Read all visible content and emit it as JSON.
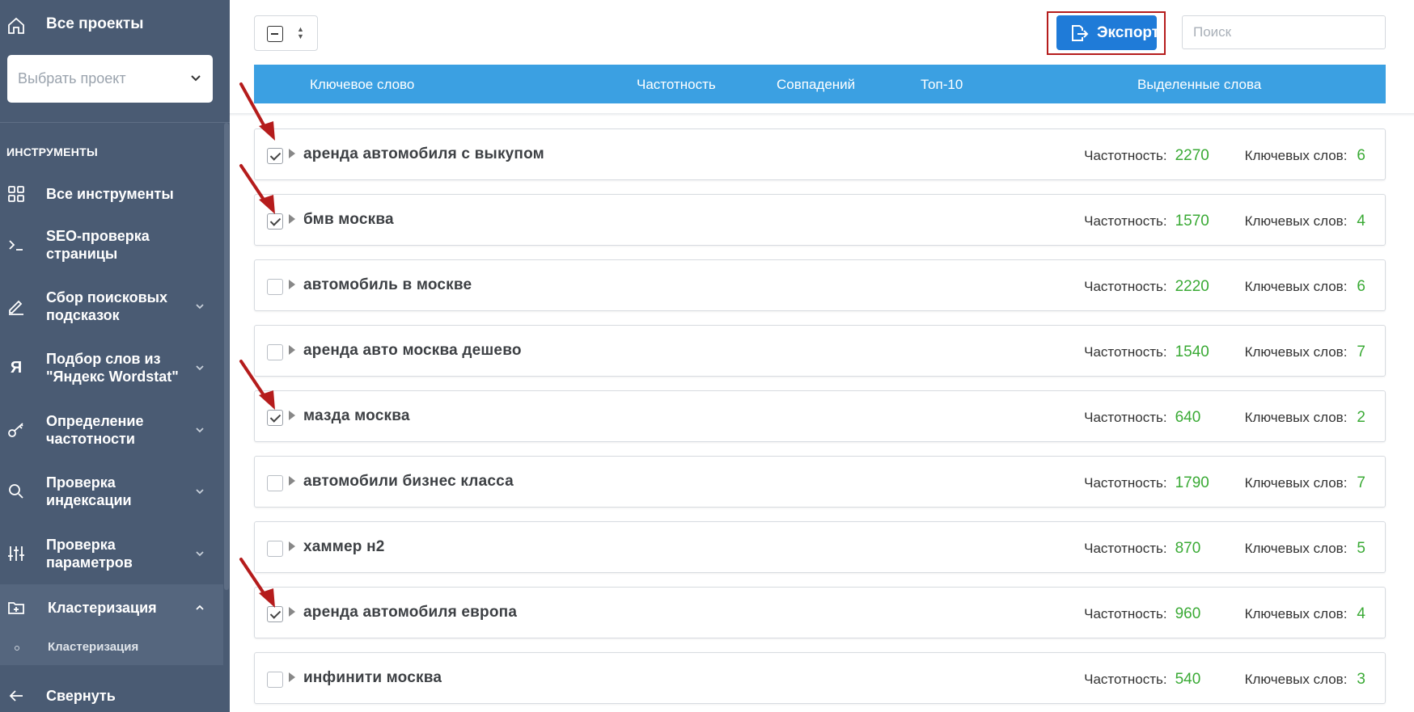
{
  "sidebar": {
    "all_projects": "Все проекты",
    "project_select_placeholder": "Выбрать проект",
    "section_title": "ИНСТРУМЕНТЫ",
    "items": [
      {
        "label": "Все инструменты",
        "icon": "grid-icon"
      },
      {
        "label": "SEO-проверка страницы",
        "icon": "terminal-icon"
      },
      {
        "label": "Сбор поисковых подсказок",
        "icon": "pencil-icon"
      },
      {
        "label": "Подбор слов из \"Яндекс Wordstat\"",
        "icon": "yandex-icon"
      },
      {
        "label": "Определение частотности",
        "icon": "key-icon"
      },
      {
        "label": "Проверка индексации",
        "icon": "search-icon"
      },
      {
        "label": "Проверка параметров",
        "icon": "sliders-icon"
      },
      {
        "label": "Кластеризация",
        "icon": "folder-plus-icon"
      }
    ],
    "sub_item": "Кластеризация",
    "collapse": "Свернуть"
  },
  "toolbar": {
    "export_label": "Экспорт",
    "search_placeholder": "Поиск"
  },
  "table": {
    "headers": {
      "keyword": "Ключевое слово",
      "frequency": "Частотность",
      "matches": "Совпадений",
      "top10": "Топ-10",
      "highlighted": "Выделенные слова"
    },
    "freq_label": "Частотность:",
    "kw_label": "Ключевых слов:",
    "rows": [
      {
        "keyword": "аренда автомобиля с выкупом",
        "frequency": "2270",
        "keywords": "6",
        "checked": true
      },
      {
        "keyword": "бмв москва",
        "frequency": "1570",
        "keywords": "4",
        "checked": true
      },
      {
        "keyword": "автомобиль в москве",
        "frequency": "2220",
        "keywords": "6",
        "checked": false
      },
      {
        "keyword": "аренда авто москва дешево",
        "frequency": "1540",
        "keywords": "7",
        "checked": false
      },
      {
        "keyword": "мазда москва",
        "frequency": "640",
        "keywords": "2",
        "checked": true
      },
      {
        "keyword": "автомобили бизнес класса",
        "frequency": "1790",
        "keywords": "7",
        "checked": false
      },
      {
        "keyword": "хаммер н2",
        "frequency": "870",
        "keywords": "5",
        "checked": false
      },
      {
        "keyword": "аренда автомобиля европа",
        "frequency": "960",
        "keywords": "4",
        "checked": true
      },
      {
        "keyword": "инфинити москва",
        "frequency": "540",
        "keywords": "3",
        "checked": false
      }
    ]
  },
  "colors": {
    "sidebar_bg": "#4a5b73",
    "header_blue": "#3ba0e2",
    "button_blue": "#1f7bd8",
    "number_green": "#3aaa35",
    "annotation_red": "#b51c1c"
  }
}
